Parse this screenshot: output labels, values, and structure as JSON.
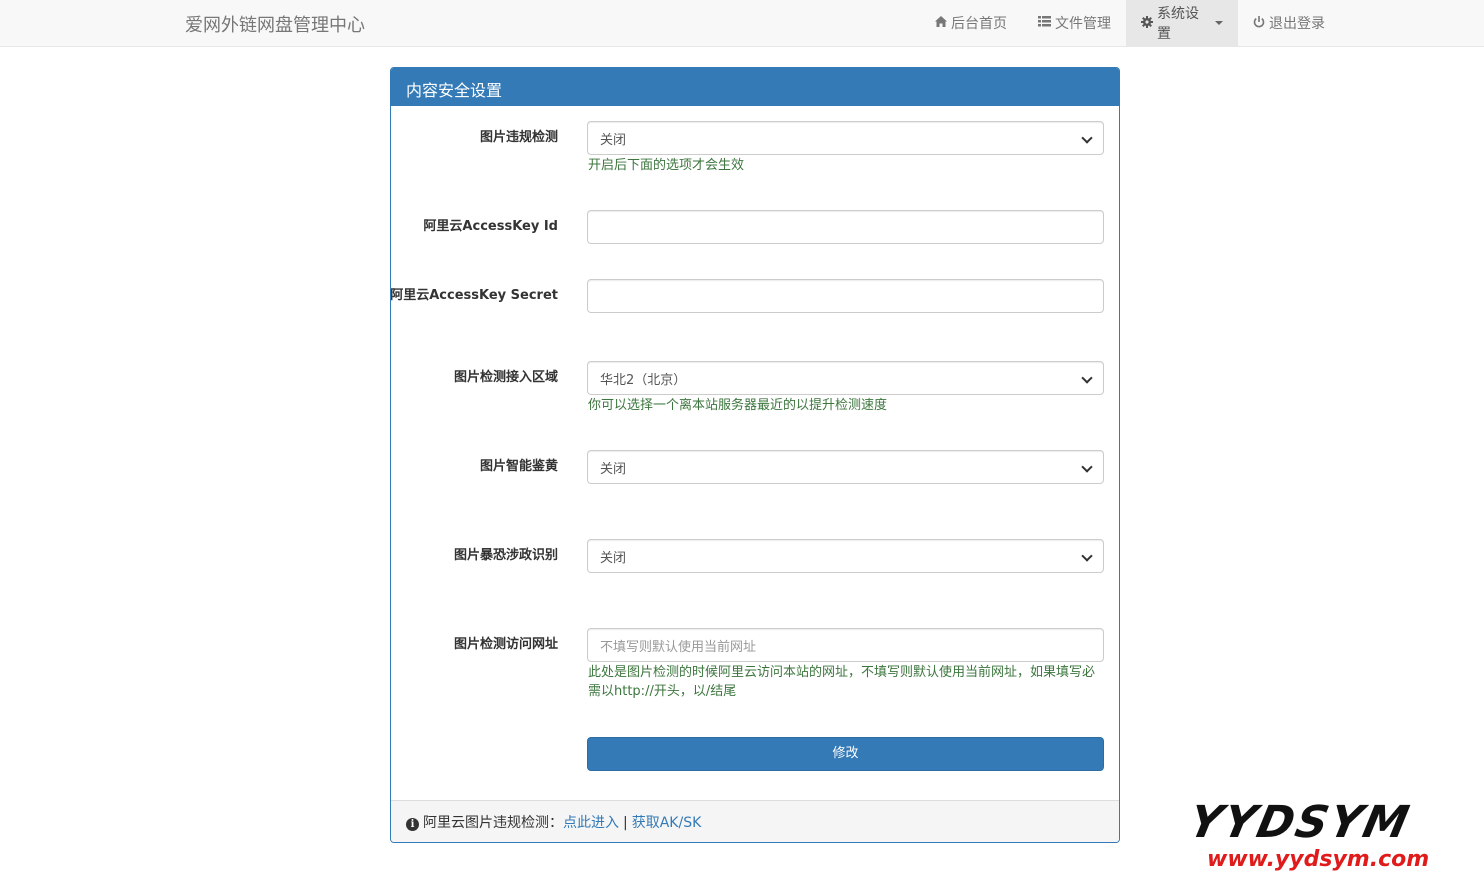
{
  "navbar": {
    "brand": "爱网外链网盘管理中心",
    "items": [
      {
        "icon": "home-icon",
        "label": "后台首页"
      },
      {
        "icon": "list-icon",
        "label": "文件管理"
      },
      {
        "icon": "gear-icon",
        "label": "系统设置"
      },
      {
        "icon": "power-icon",
        "label": "退出登录"
      }
    ]
  },
  "panel": {
    "title": "内容安全设置",
    "fields": {
      "image_check": {
        "label": "图片违规检测",
        "value": "关闭",
        "help": "开启后下面的选项才会生效"
      },
      "access_key_id": {
        "label": "阿里云AccessKey Id",
        "value": ""
      },
      "access_key_secret": {
        "label": "阿里云AccessKey Secret",
        "value": ""
      },
      "region": {
        "label": "图片检测接入区域",
        "value": "华北2（北京）",
        "help": "你可以选择一个离本站服务器最近的以提升检测速度"
      },
      "porn_check": {
        "label": "图片智能鉴黄",
        "value": "关闭"
      },
      "terror_check": {
        "label": "图片暴恐涉政识别",
        "value": "关闭"
      },
      "access_url": {
        "label": "图片检测访问网址",
        "value": "",
        "placeholder": "不填写则默认使用当前网址",
        "help": "此处是图片检测的时候阿里云访问本站的网址，不填写则默认使用当前网址，如果填写必需以http://开头，以/结尾"
      }
    },
    "submit_label": "修改",
    "footer": {
      "text": "阿里云图片违规检测：",
      "link1": "点此进入",
      "separator": "|",
      "link2": "获取AK/SK"
    }
  },
  "watermark": {
    "top": "YYDSYM",
    "bottom": "www.yydsym.com"
  },
  "colors": {
    "primary": "#337ab7",
    "help_text": "#3c763d",
    "navbar_bg": "#f8f8f8"
  }
}
